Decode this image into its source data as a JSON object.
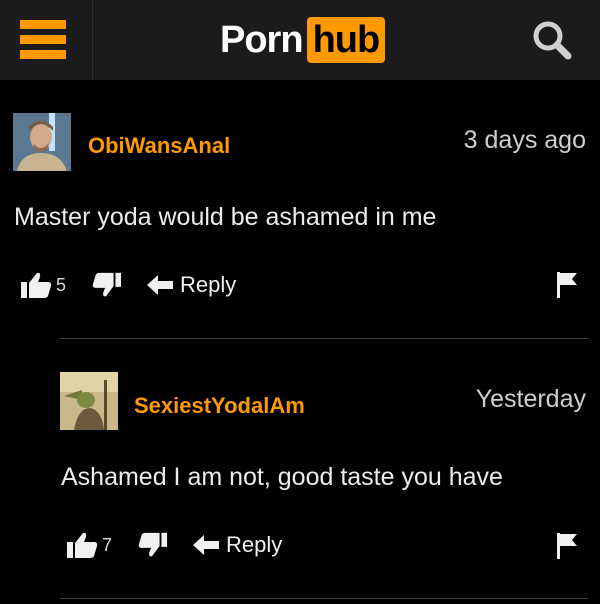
{
  "header": {
    "logo_part1": "Porn",
    "logo_part2": "hub",
    "accent": "#ff9900",
    "menu_icon": "hamburger-icon",
    "search_icon": "search-icon"
  },
  "comments": [
    {
      "username": "ObiWansAnal",
      "timestamp": "3 days ago",
      "text": "Master yoda would be ashamed in me",
      "likes": "5",
      "reply_label": "Reply",
      "avatar": "obi-wan-avatar"
    },
    {
      "username": "SexiestYodalAm",
      "timestamp": "Yesterday",
      "text": "Ashamed I am not, good taste you have",
      "likes": "7",
      "reply_label": "Reply",
      "avatar": "yoda-avatar"
    }
  ]
}
